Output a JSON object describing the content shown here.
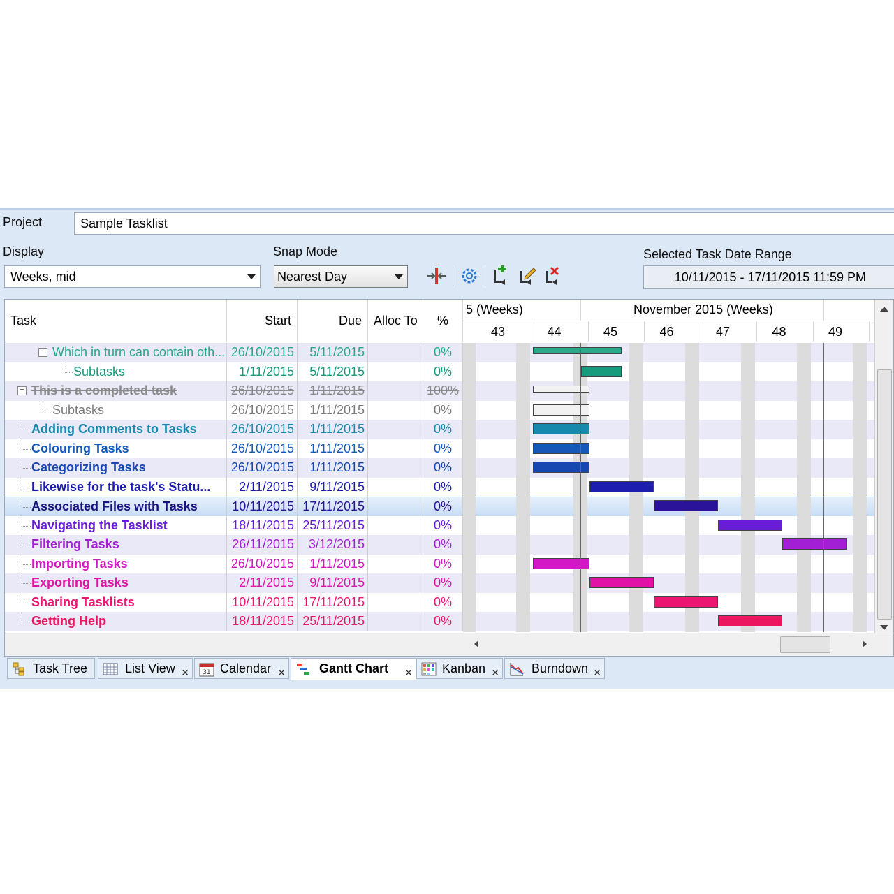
{
  "project": {
    "label": "Project",
    "value": "Sample Tasklist"
  },
  "display": {
    "label": "Display",
    "value": "Weeks, mid"
  },
  "snap": {
    "label": "Snap Mode",
    "value": "Nearest Day"
  },
  "toolbar": {
    "icons": [
      "split-task-icon",
      "settings-icon",
      "add-dependency-icon",
      "edit-dependency-icon",
      "delete-dependency-icon"
    ]
  },
  "date_range": {
    "label": "Selected Task Date Range",
    "value": "10/11/2015 - 17/11/2015 11:59 PM"
  },
  "columns": {
    "task": "Task",
    "start": "Start",
    "due": "Due",
    "alloc": "Alloc To",
    "pct": "%"
  },
  "timeline": {
    "left_header": "5 (Weeks)",
    "month_header": "November 2015 (Weeks)",
    "weeks": [
      "43",
      "44",
      "45",
      "46",
      "47",
      "48",
      "49"
    ]
  },
  "tasks": [
    {
      "name": "Which in turn can contain oth...",
      "start": "26/10/2015",
      "due": "5/11/2015",
      "pct": "0%",
      "color": "#2aa88a"
    },
    {
      "name": "Subtasks",
      "start": "1/11/2015",
      "due": "5/11/2015",
      "pct": "0%",
      "color": "#179b7c"
    },
    {
      "name": "This is a completed task",
      "start": "26/10/2015",
      "due": "1/11/2015",
      "pct": "100%",
      "color": "#8a8a8a"
    },
    {
      "name": "Subtasks",
      "start": "26/10/2015",
      "due": "1/11/2015",
      "pct": "0%",
      "color": "#7a7a7a"
    },
    {
      "name": "Adding Comments to Tasks",
      "start": "26/10/2015",
      "due": "1/11/2015",
      "pct": "0%",
      "color": "#1689ad"
    },
    {
      "name": "Colouring Tasks",
      "start": "26/10/2015",
      "due": "1/11/2015",
      "pct": "0%",
      "color": "#1558b8"
    },
    {
      "name": "Categorizing Tasks",
      "start": "26/10/2015",
      "due": "1/11/2015",
      "pct": "0%",
      "color": "#1747b0"
    },
    {
      "name": "Likewise for the task's Statu...",
      "start": "2/11/2015",
      "due": "9/11/2015",
      "pct": "0%",
      "color": "#1d1db0"
    },
    {
      "name": "Associated Files with Tasks",
      "start": "10/11/2015",
      "due": "17/11/2015",
      "pct": "0%",
      "color": "#2a1299"
    },
    {
      "name": "Navigating the Tasklist",
      "start": "18/11/2015",
      "due": "25/11/2015",
      "pct": "0%",
      "color": "#6a1dd6"
    },
    {
      "name": "Filtering Tasks",
      "start": "26/11/2015",
      "due": "3/12/2015",
      "pct": "0%",
      "color": "#a31fd6"
    },
    {
      "name": "Importing Tasks",
      "start": "26/10/2015",
      "due": "1/11/2015",
      "pct": "0%",
      "color": "#d316c6"
    },
    {
      "name": "Exporting Tasks",
      "start": "2/11/2015",
      "due": "9/11/2015",
      "pct": "0%",
      "color": "#e013a6"
    },
    {
      "name": "Sharing Tasklists",
      "start": "10/11/2015",
      "due": "17/11/2015",
      "pct": "0%",
      "color": "#ec1572"
    },
    {
      "name": "Getting Help",
      "start": "18/11/2015",
      "due": "25/11/2015",
      "pct": "0%",
      "color": "#ec1560"
    }
  ],
  "tabs": [
    {
      "label": "Task Tree",
      "icon": "task-tree-icon"
    },
    {
      "label": "List View",
      "icon": "list-view-icon"
    },
    {
      "label": "Calendar",
      "icon": "calendar-icon",
      "icon_text": "31"
    },
    {
      "label": "Gantt Chart",
      "icon": "gantt-chart-icon"
    },
    {
      "label": "Kanban",
      "icon": "kanban-icon"
    },
    {
      "label": "Burndown",
      "icon": "burndown-icon"
    }
  ]
}
